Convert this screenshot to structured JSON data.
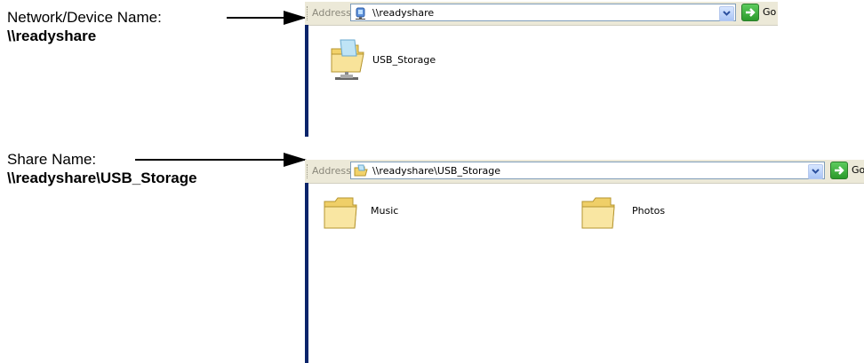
{
  "callouts": {
    "network": {
      "label": "Network/Device Name:",
      "value": "\\\\readyshare"
    },
    "share": {
      "label": "Share Name:",
      "value": "\\\\readyshare\\USB_Storage"
    }
  },
  "window1": {
    "address_label": "Address",
    "address_value": "\\\\readyshare",
    "go_label": "Go",
    "items": [
      {
        "name": "USB_Storage",
        "icon": "shared-folder-icon"
      }
    ]
  },
  "window2": {
    "address_label": "Address",
    "address_value": "\\\\readyshare\\USB_Storage",
    "go_label": "Go",
    "items": [
      {
        "name": "Music",
        "icon": "folder-icon"
      },
      {
        "name": "Photos",
        "icon": "folder-icon"
      }
    ]
  },
  "colors": {
    "toolbar": "#ECE9D8",
    "selection_edge": "#0a246a",
    "go_green": "#2b9a2b"
  }
}
